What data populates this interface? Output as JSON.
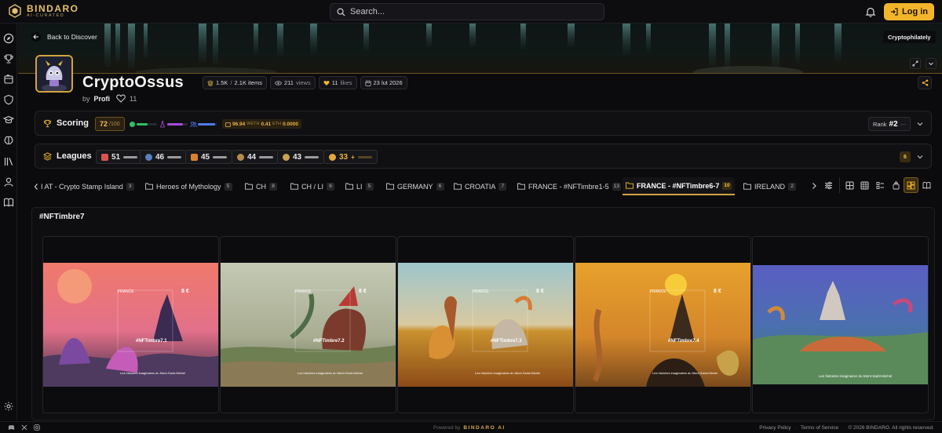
{
  "app": {
    "name": "BINDARO",
    "tagline": "AI-CURATED"
  },
  "search": {
    "placeholder": "Search..."
  },
  "header": {
    "login_label": "Log in"
  },
  "banner": {
    "back_label": "Back to Discover",
    "category_chip": "Cryptophilately"
  },
  "collection": {
    "title": "CryptoOssus",
    "by_label": "by",
    "author": "Profi",
    "favorites": "11",
    "stats": {
      "owners": "1.5K",
      "items": "2.1K items",
      "views": "211",
      "views_label": "views",
      "likes": "11",
      "likes_label": "likes",
      "date": "23 lut 2026"
    }
  },
  "scoring": {
    "title": "Scoring",
    "score": "72",
    "score_max": "/100",
    "meters": [
      {
        "color": "#2fbf64",
        "fill": 0.55
      },
      {
        "color": "#a64bd9",
        "fill": 0.75
      },
      {
        "color": "#4d7cf0",
        "fill": 0.9
      }
    ],
    "eth_main": "96.94",
    "eth_unit": "WETH",
    "eth_value": "0.41",
    "eth_unit2": "ETH",
    "eth_value2": "0.0000",
    "rank_label": "Rank",
    "rank_value": "#2",
    "rank_delta": "---"
  },
  "leagues": {
    "title": "Leagues",
    "chips": [
      {
        "value": "51",
        "icon": "league-red-icon"
      },
      {
        "value": "46",
        "icon": "league-blue-icon"
      },
      {
        "value": "45",
        "icon": "league-orange-icon"
      },
      {
        "value": "44",
        "icon": "league-bronze-icon"
      },
      {
        "value": "43",
        "icon": "league-silver-icon"
      },
      {
        "value": "33",
        "icon": "league-gold-icon",
        "suffix": "+"
      }
    ],
    "count": "6"
  },
  "folders": [
    {
      "label": "I AT - Crypto Stamp Island",
      "count": "3"
    },
    {
      "label": "Heroes of Mythology",
      "count": "5"
    },
    {
      "label": "CH",
      "count": "8"
    },
    {
      "label": "CH / LI",
      "count": "6"
    },
    {
      "label": "LI",
      "count": "5"
    },
    {
      "label": "GERMANY",
      "count": "6"
    },
    {
      "label": "CROATIA",
      "count": "7"
    },
    {
      "label": "FRANCE - #NFTimbre1-5",
      "count": "13"
    },
    {
      "label": "FRANCE - #NFTimbre6-7",
      "count": "10"
    },
    {
      "label": "IRELAND",
      "count": "2"
    }
  ],
  "gallery": {
    "title": "#NFTimbre7",
    "stamps": [
      {
        "country": "FRANCE",
        "value": "8 €",
        "code": "#NFTimbre7.1",
        "caption": "Les histoires imaginaires du Mont-Saint-Michel"
      },
      {
        "country": "FRANCE",
        "value": "8 €",
        "code": "#NFTimbre7.2",
        "caption": "Les histoires imaginaires du Mont-Saint-Michel"
      },
      {
        "country": "FRANCE",
        "value": "8 €",
        "code": "#NFTimbre7.3",
        "caption": "Les histoires imaginaires du Mont-Saint-Michel"
      },
      {
        "country": "FRANCE",
        "value": "8 €",
        "code": "#NFTimbre7.4",
        "caption": "Les histoires imaginaires du Mont-Saint-Michel"
      },
      {
        "country": "",
        "value": "",
        "code": "",
        "caption": "Les histoires imaginaires du Mont-Saint-Michel"
      }
    ]
  },
  "footer": {
    "powered_by": "Powered by",
    "powered_brand": "BINDARO AI",
    "privacy": "Privacy Policy",
    "terms": "Terms of Service",
    "copyright": "© 2026 BINDARO. All rights reserved."
  },
  "colors": {
    "accent": "#f2b52a",
    "gold": "#d2a43f",
    "background": "#0b0b0d"
  }
}
